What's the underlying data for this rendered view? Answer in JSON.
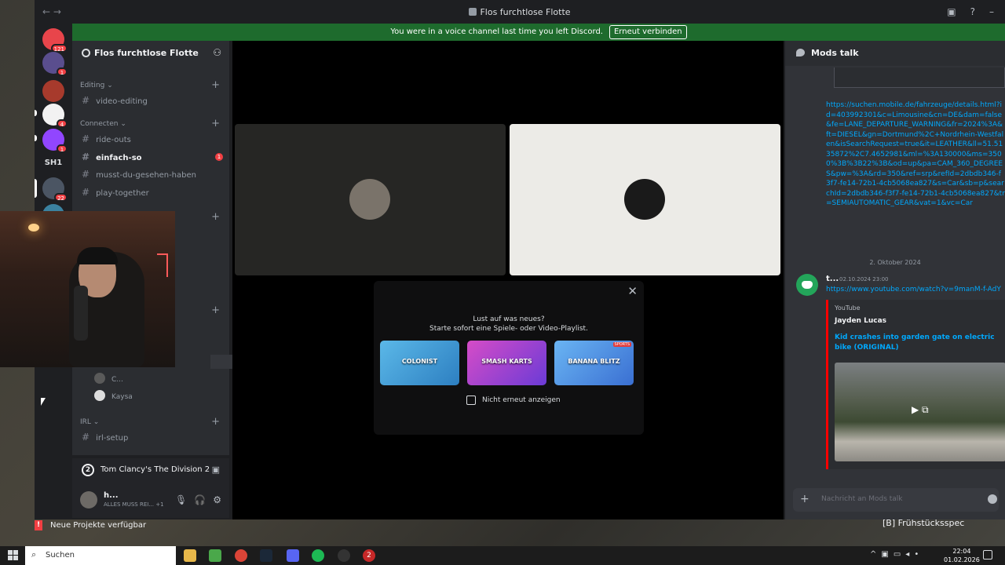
{
  "window": {
    "title": "Flos furchtlose Flotte"
  },
  "notice": {
    "text": "You were in a voice channel last time you left Discord.",
    "button": "Erneut verbinden"
  },
  "servers": {
    "badge_top": "121",
    "badge_1": "1",
    "badge_2": "4",
    "badge_3": "1",
    "badge_4": "22",
    "text_server": "SH1"
  },
  "guild": {
    "name": "Flos furchtlose Flotte"
  },
  "sidebar": {
    "cat_editing": "Editing ⌄",
    "ch_video_editing": "video-editing",
    "cat_connecten": "Connecten ⌄",
    "ch_ride_outs": "ride-outs",
    "ch_einfach_so": "einfach-so",
    "ch_einfach_so_unread": "1",
    "ch_musst": "musst-du-gesehen-haben",
    "ch_play": "play-together",
    "vc_user_1": "C...",
    "vc_user_2": "Kaysa",
    "cat_irl": "IRL ⌄",
    "ch_irl_setup": "irl-setup"
  },
  "activity": {
    "icon_number": "2",
    "game": "Tom Clancy's The Division 2"
  },
  "user": {
    "name": "h...",
    "status": "ALLES MUSS REI...",
    "extra": "+1"
  },
  "popup": {
    "line1": "Lust auf was neues?",
    "line2": "Starte sofort eine Spiele- oder Video-Playlist.",
    "game1": "COLONIST",
    "game2": "SMASH KARTS",
    "game3": "BANANA BLITZ",
    "game3_tag": "SPORTS",
    "checkbox_label": "Nicht erneut anzeigen"
  },
  "chat": {
    "channel": "Mods talk",
    "long_link": "https://suchen.mobile.de/fahrzeuge/details.html?id=403992301&c=Limousine&cn=DE&dam=false&fe=LANE_DEPARTURE_WARNING&fr=2024%3A&ft=DIESEL&gn=Dortmund%2C+Nordrhein-Westfalen&isSearchRequest=true&it=LEATHER&ll=51.5135872%2C7.4652981&ml=%3A130000&ms=3500%3B%3B22%3B&od=up&pa=CAM_360_DEGREES&pw=%3A&rd=350&ref=srp&refId=2dbdb346-f3f7-fe14-72b1-4cb5068ea827&s=Car&sb=p&searchId=2dbdb346-f3f7-fe14-72b1-4cb5068ea827&tr=SEMIAUTOMATIC_GEAR&vat=1&vc=Car",
    "date_divider": "2. Oktober 2024",
    "author": "t...",
    "timestamp": "02.10.2024 23:00",
    "link": "https://www.youtube.com/watch?v=9manM-f-AdY",
    "embed_provider": "YouTube",
    "embed_author": "Jayden Lucas",
    "embed_title": "Kid crashes into garden gate on electric bike (ORIGINAL)",
    "input_placeholder": "Nachricht an Mods talk"
  },
  "notification": {
    "text": "Neue Projekte verfügbar"
  },
  "overlay": {
    "text": "[B] Frühstücksspec"
  },
  "taskbar": {
    "search": "Suchen",
    "app_counter": "2",
    "time": "22:04",
    "date": "01.02.2026"
  },
  "colors": {
    "notice_green": "#1e6b2d",
    "link_blue": "#00a8fc",
    "unread_red": "#f23f43",
    "youtube_red": "#ff0000",
    "discord_green": "#23a55a"
  }
}
